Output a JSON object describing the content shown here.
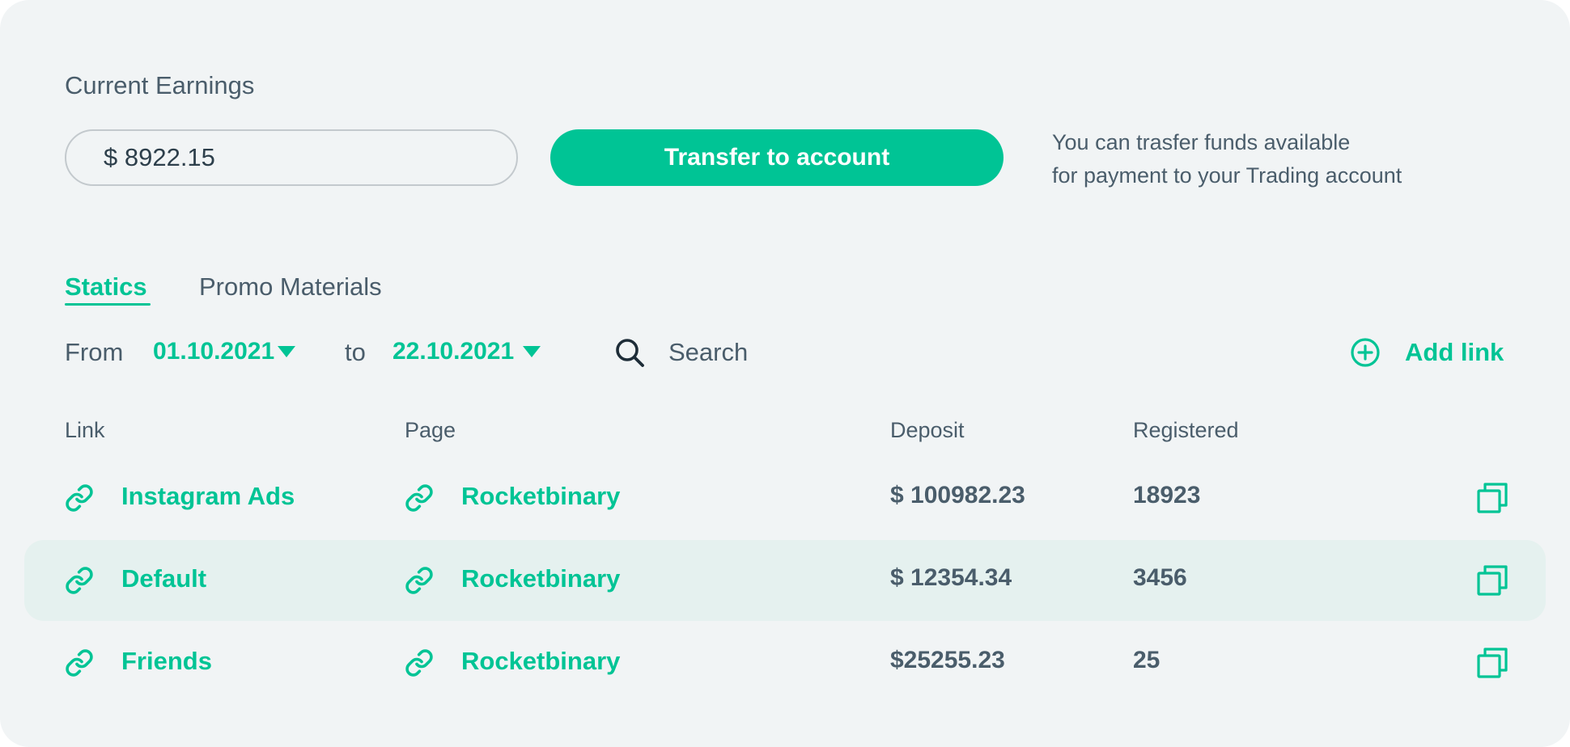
{
  "earnings": {
    "label": "Current Earnings",
    "amount": "$ 8922.15",
    "transfer_label": "Transfer to account",
    "info_line1": "You can trasfer funds available",
    "info_line2": "for payment to your Trading account"
  },
  "tabs": [
    {
      "label": "Statics",
      "active": true
    },
    {
      "label": "Promo Materials",
      "active": false
    }
  ],
  "filter": {
    "from_label": "From",
    "from_date": "01.10.2021",
    "to_label": "to",
    "to_date": "22.10.2021",
    "search_placeholder": "Search",
    "add_link_label": "Add link"
  },
  "table": {
    "headers": [
      "Link",
      "Page",
      "Deposit",
      "Registered"
    ],
    "rows": [
      {
        "link": "Instagram Ads",
        "page": "Rocketbinary",
        "deposit": "$ 100982.23",
        "registered": "18923",
        "highlight": false
      },
      {
        "link": "Default",
        "page": "Rocketbinary",
        "deposit": "$ 12354.34",
        "registered": "3456",
        "highlight": true
      },
      {
        "link": "Friends",
        "page": "Rocketbinary",
        "deposit": "$25255.23",
        "registered": "25",
        "highlight": false
      }
    ]
  },
  "colors": {
    "accent": "#00c495",
    "text": "#4a5d6b",
    "background": "#f1f4f5",
    "row_highlight": "#e5f1ef"
  },
  "icons": {
    "search": "search-icon",
    "add": "plus-circle-icon",
    "link": "link-icon",
    "copy": "copy-icon",
    "dropdown": "caret-down-icon"
  }
}
